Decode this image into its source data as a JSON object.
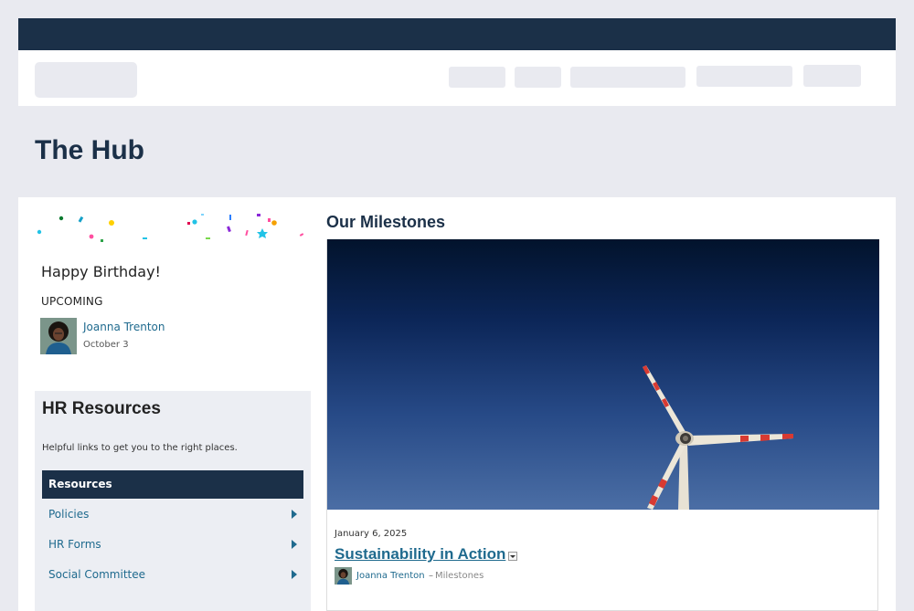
{
  "site": {
    "title": "The Hub"
  },
  "birthday": {
    "title": "Happy Birthday!",
    "upcoming_label": "UPCOMING",
    "person": {
      "name": "Joanna Trenton",
      "date": "October 3"
    }
  },
  "hr_resources": {
    "title": "HR Resources",
    "subtitle": "Helpful links to get you to the right places.",
    "header": "Resources",
    "links": [
      {
        "label": "Policies"
      },
      {
        "label": "HR Forms"
      },
      {
        "label": "Social Committee"
      }
    ]
  },
  "milestones": {
    "title": "Our Milestones",
    "post": {
      "date": "January 6, 2025",
      "title": "Sustainability in Action",
      "author": "Joanna Trenton",
      "separator": "–",
      "category": "Milestones",
      "image_subject": "wind turbine against blue sky"
    }
  },
  "colors": {
    "header_navy": "#1b3048",
    "link_blue": "#1f6a8e",
    "page_bg": "#e9eaf0",
    "panel_bg": "#eceef3"
  }
}
